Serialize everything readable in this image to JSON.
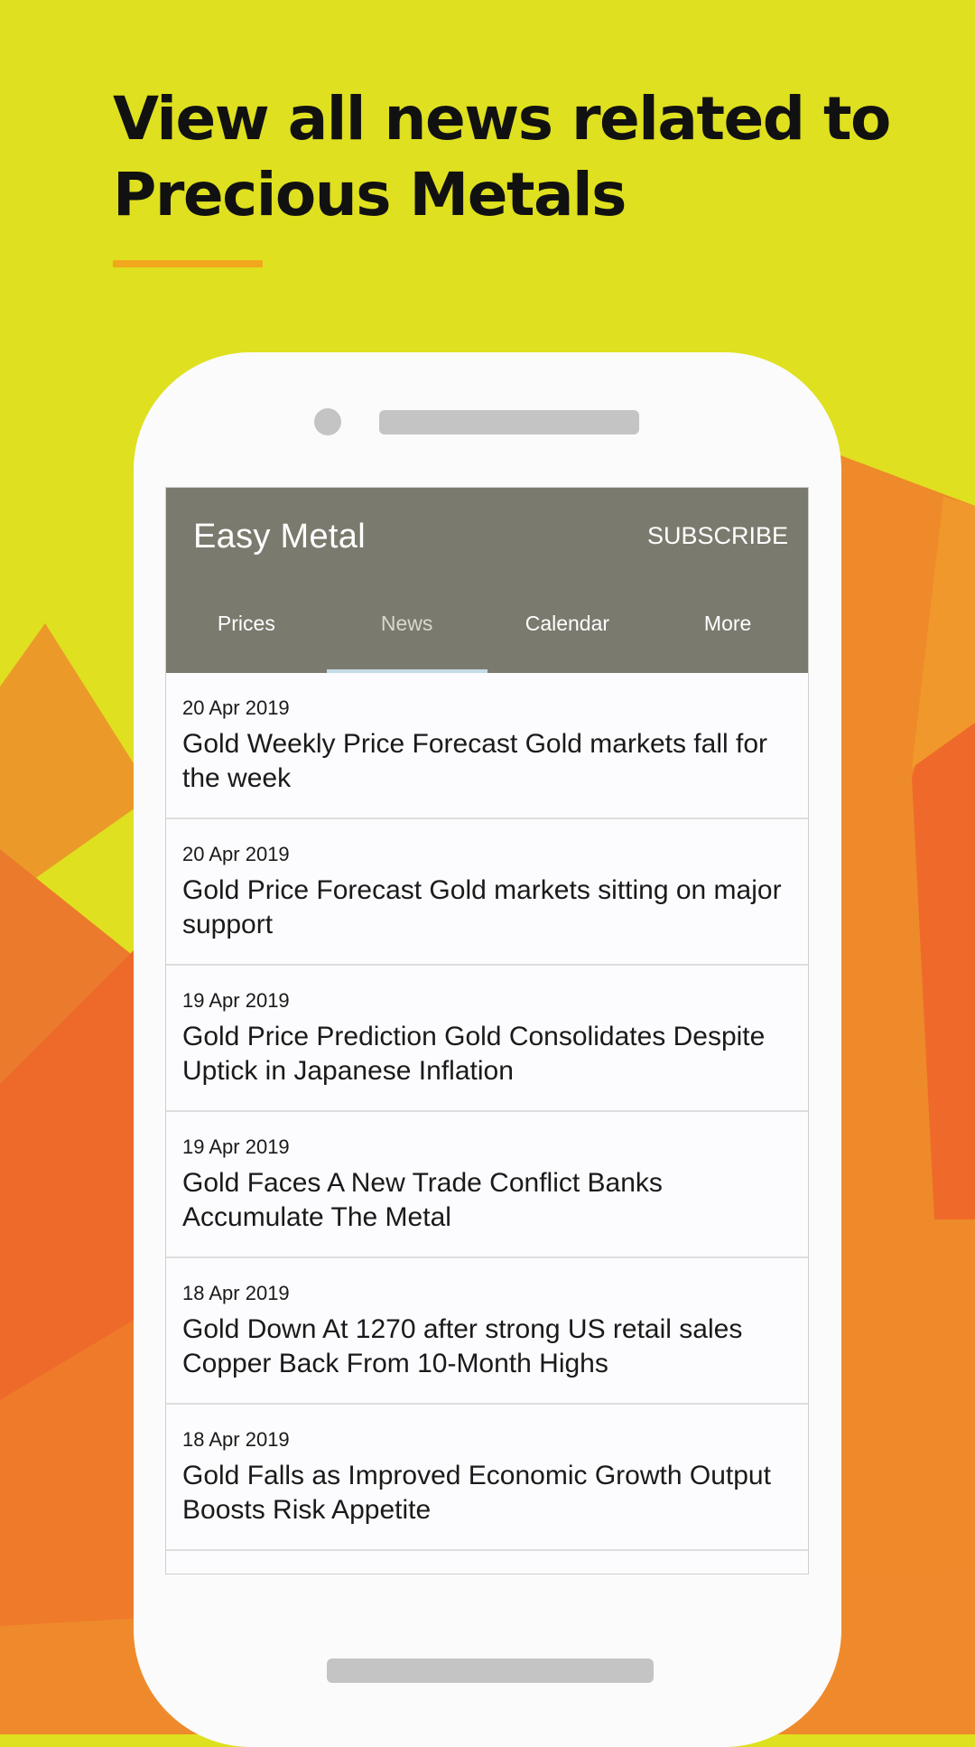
{
  "headline": {
    "line1": "View all news related to",
    "line2": "Precious Metals"
  },
  "colors": {
    "background": "#dfe01f",
    "accent": "#f2a81c",
    "appbar": "#7b7a6e"
  },
  "app": {
    "title": "Easy Metal",
    "subscribe_label": "SUBSCRIBE"
  },
  "tabs": [
    {
      "label": "Prices"
    },
    {
      "label": "News"
    },
    {
      "label": "Calendar"
    },
    {
      "label": "More"
    }
  ],
  "active_tab": "News",
  "news": [
    {
      "date": "20 Apr 2019",
      "title": "Gold Weekly Price Forecast  Gold markets fall for the week"
    },
    {
      "date": "20 Apr 2019",
      "title": "Gold Price Forecast  Gold markets sitting on major support"
    },
    {
      "date": "19 Apr 2019",
      "title": "Gold Price Prediction  Gold Consolidates Despite Uptick in Japanese Inflation"
    },
    {
      "date": "19 Apr 2019",
      "title": "Gold Faces A New Trade Conflict Banks Accumulate The Metal"
    },
    {
      "date": "18 Apr 2019",
      "title": "Gold Down At 1270 after strong US retail sales Copper Back From 10-Month Highs"
    },
    {
      "date": "18 Apr 2019",
      "title": "Gold Falls as Improved Economic Growth Output Boosts Risk Appetite"
    }
  ]
}
